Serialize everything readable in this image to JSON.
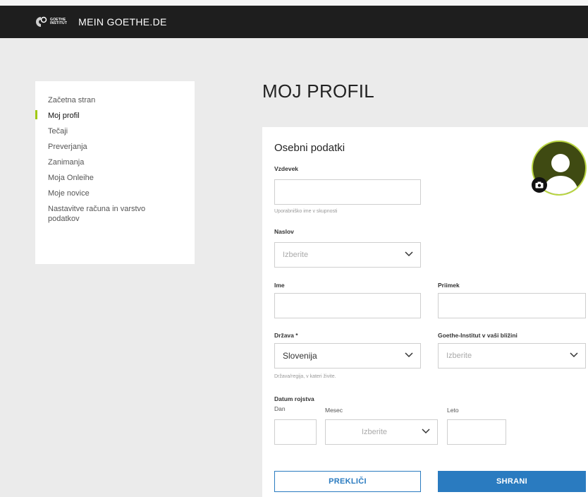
{
  "header": {
    "logo_line1": "GOETHE",
    "logo_line2": "INSTITUT",
    "site_title": "MEIN GOETHE.DE"
  },
  "sidebar": {
    "items": [
      {
        "label": "Začetna stran",
        "active": false
      },
      {
        "label": "Moj profil",
        "active": true
      },
      {
        "label": "Tečaji",
        "active": false
      },
      {
        "label": "Preverjanja",
        "active": false
      },
      {
        "label": "Zanimanja",
        "active": false
      },
      {
        "label": "Moja Onleihe",
        "active": false
      },
      {
        "label": "Moje novice",
        "active": false
      },
      {
        "label": "Nastavitve računa in varstvo podatkov",
        "active": false
      }
    ]
  },
  "main": {
    "page_title": "MOJ PROFIL",
    "section_title": "Osebni podatki",
    "nickname": {
      "label": "Vzdevek",
      "value": "",
      "hint": "Uporabniško ime v skupnosti"
    },
    "salutation": {
      "label": "Naslov",
      "value": "Izberite"
    },
    "first_name": {
      "label": "Ime",
      "value": ""
    },
    "last_name": {
      "label": "Priimek",
      "value": ""
    },
    "country": {
      "label": "Država *",
      "value": "Slovenija",
      "hint": "Država/regija, v kateri živite."
    },
    "institute": {
      "label": "Goethe-Institut v vaši bližini",
      "value": "Izberite"
    },
    "birthdate": {
      "label": "Datum rojstva",
      "day_label": "Dan",
      "month_label": "Mesec",
      "year_label": "Leto",
      "day_value": "",
      "month_value": "Izberite",
      "year_value": ""
    },
    "buttons": {
      "cancel": "PREKLIČI",
      "save": "SHRANI"
    }
  },
  "colors": {
    "accent_green": "#a0c814",
    "primary_blue": "#2a7bc0",
    "header_bg": "#1e1e1e"
  }
}
